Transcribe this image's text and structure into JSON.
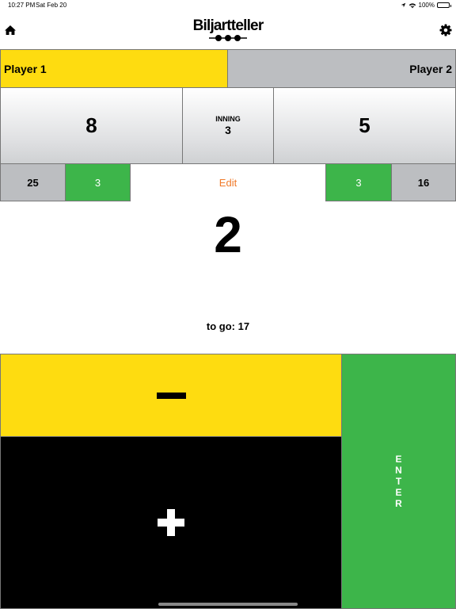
{
  "status_bar": {
    "time": "10:27 PM",
    "date": "Sat Feb 20",
    "battery": "100%"
  },
  "header": {
    "logo_text": "Biljartteller"
  },
  "players": {
    "player1_name": "Player 1",
    "player2_name": "Player 2",
    "active_color": "#fedc10",
    "inactive_color": "#bcbec1"
  },
  "scores": {
    "player1": "8",
    "player2": "5"
  },
  "inning": {
    "label": "INNING",
    "value": "3"
  },
  "stats": {
    "player1_target": "25",
    "player1_green": "3",
    "edit_label": "Edit",
    "player2_green": "3",
    "player2_target": "16"
  },
  "current_run": "2",
  "to_go": "to go: 17",
  "keypad": {
    "minus_symbol": "−",
    "plus_symbol": "+",
    "enter_label": "ENTER"
  },
  "colors": {
    "yellow": "#fedc10",
    "green": "#3db54a",
    "gray": "#bcbec1",
    "orange": "#f07a2a"
  }
}
